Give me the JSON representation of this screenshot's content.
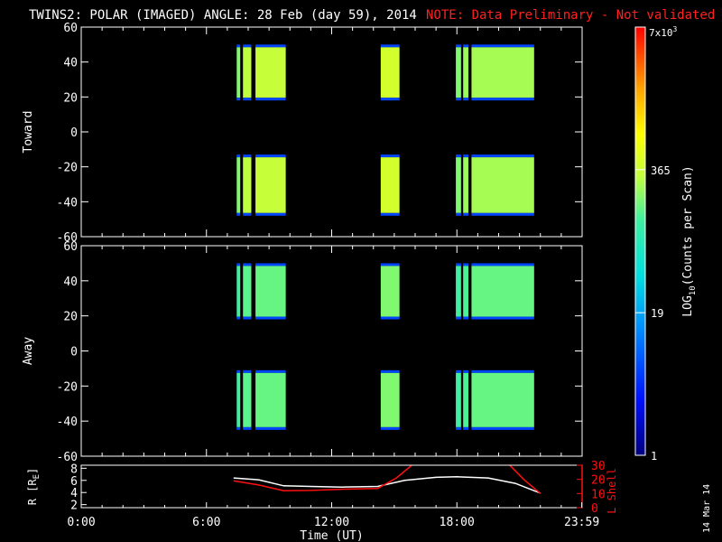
{
  "header": {
    "title": "TWINS2: POLAR (IMAGED) ANGLE: 28 Feb (day  59), 2014",
    "note": "NOTE: Data Preliminary - Not validated",
    "note_color": "#ff2020"
  },
  "side_date": "14 Mar 14",
  "chart_data": [
    {
      "type": "heatmap",
      "panel": "toward",
      "ylabel": "Toward",
      "ylim": [
        -60,
        60
      ],
      "yticks": [
        -60,
        -40,
        -20,
        0,
        20,
        40,
        60
      ],
      "xlim": [
        0,
        24
      ],
      "bands": [
        [
          18,
          50
        ],
        [
          -48,
          -13
        ]
      ],
      "blocks": [
        {
          "start": 7.45,
          "end": 7.62,
          "level": 0.6
        },
        {
          "start": 7.75,
          "end": 8.15,
          "level": 0.65
        },
        {
          "start": 8.35,
          "end": 9.8,
          "level": 0.66
        },
        {
          "start": 14.35,
          "end": 15.25,
          "level": 0.68
        },
        {
          "start": 17.95,
          "end": 18.2,
          "level": 0.6
        },
        {
          "start": 18.3,
          "end": 18.55,
          "level": 0.62
        },
        {
          "start": 18.7,
          "end": 21.7,
          "level": 0.63
        }
      ]
    },
    {
      "type": "heatmap",
      "panel": "away",
      "ylabel": "Away",
      "ylim": [
        -60,
        60
      ],
      "yticks": [
        -60,
        -40,
        -20,
        0,
        20,
        40,
        60
      ],
      "xlim": [
        0,
        24
      ],
      "bands": [
        [
          18,
          50
        ],
        [
          -45,
          -11
        ]
      ],
      "blocks": [
        {
          "start": 7.45,
          "end": 7.62,
          "level": 0.55
        },
        {
          "start": 7.75,
          "end": 8.15,
          "level": 0.57
        },
        {
          "start": 8.35,
          "end": 9.8,
          "level": 0.58
        },
        {
          "start": 14.35,
          "end": 15.25,
          "level": 0.6
        },
        {
          "start": 17.95,
          "end": 18.2,
          "level": 0.55
        },
        {
          "start": 18.3,
          "end": 18.55,
          "level": 0.56
        },
        {
          "start": 18.7,
          "end": 21.7,
          "level": 0.58
        }
      ]
    },
    {
      "type": "line",
      "panel": "orbit",
      "ylabel": "R [RE]",
      "ylabel_main": "R [R",
      "ylabel_sub": "E",
      "ylabel_end": "]",
      "ylim": [
        1.5,
        8.5
      ],
      "yticks": [
        2,
        4,
        6,
        8
      ],
      "y2label": "L Shell",
      "y2lim": [
        0,
        30
      ],
      "y2ticks": [
        0,
        10,
        20,
        30
      ],
      "y2color": "#ff1010",
      "xlabel": "Time (UT)",
      "xticks": [
        0,
        6,
        12,
        18,
        23.983
      ],
      "xticklabels": [
        "0:00",
        "6:00",
        "12:00",
        "18:00",
        "23:59"
      ],
      "series": [
        {
          "axis": "R",
          "color": "#ffffff",
          "x": [
            7.3,
            8.5,
            9.7,
            11,
            12.5,
            14.2,
            15.5,
            17,
            18,
            19.5,
            20.8,
            22.0
          ],
          "y": [
            6.4,
            6.1,
            5.1,
            5.0,
            4.9,
            5.0,
            6.0,
            6.5,
            6.6,
            6.4,
            5.5,
            3.9
          ]
        },
        {
          "axis": "L",
          "color": "#ff1010",
          "x": [
            7.3,
            8.5,
            9.7,
            11,
            12.5,
            14.2,
            15.1,
            16.0
          ],
          "y": [
            19,
            16,
            12,
            12.2,
            13,
            13.6,
            21,
            32
          ]
        },
        {
          "axis": "L",
          "color": "#ff1010",
          "x": [
            20.4,
            21.2,
            22.0
          ],
          "y": [
            32,
            20,
            10
          ]
        }
      ]
    }
  ],
  "colorbar": {
    "label_main": "LOG",
    "label_sub": "10",
    "label_end": "(Counts per Scan)",
    "top_label": "7x10",
    "top_label_exp": "3",
    "ticks": [
      {
        "label": "365",
        "frac": 0.667
      },
      {
        "label": "19",
        "frac": 0.333
      },
      {
        "label": "1",
        "frac": 0.0
      }
    ]
  }
}
